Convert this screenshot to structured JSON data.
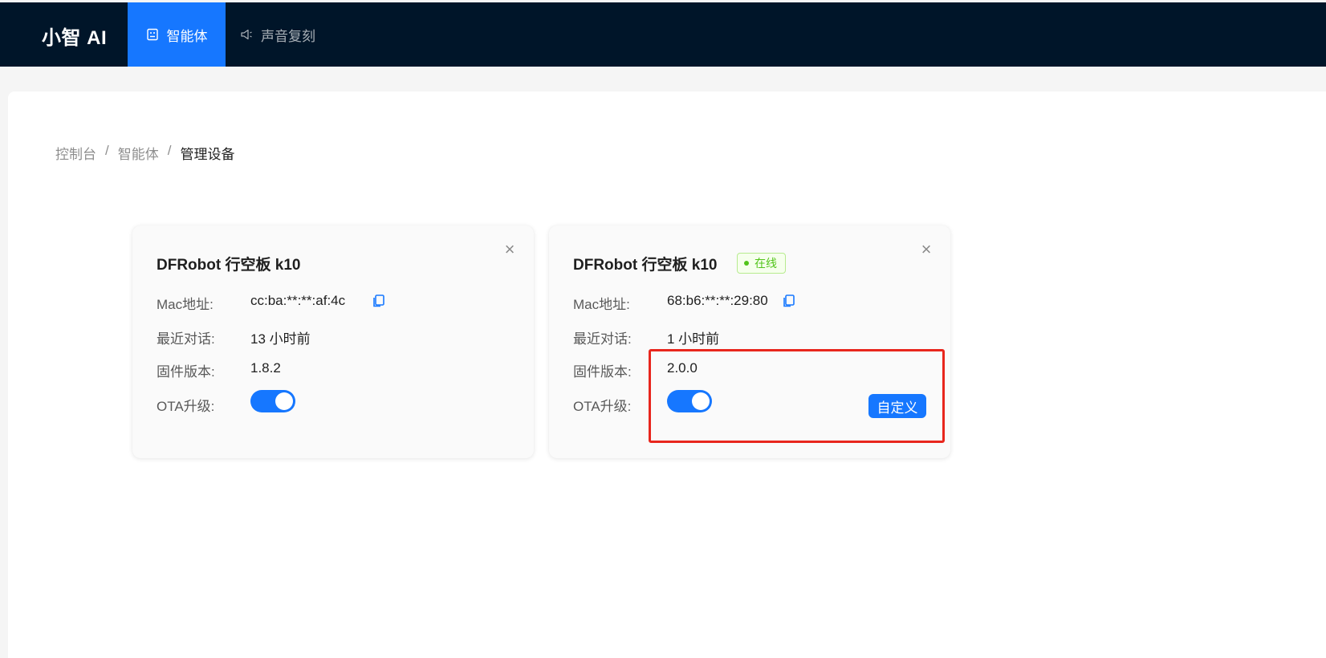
{
  "header": {
    "brand": "小智 AI",
    "nav": [
      {
        "label": "智能体",
        "icon": "robot-icon",
        "active": true
      },
      {
        "label": "声音复刻",
        "icon": "sound-icon",
        "active": false
      }
    ],
    "active_color": "#1677ff",
    "background": "#001529"
  },
  "breadcrumb": {
    "items": [
      "控制台",
      "智能体",
      "管理设备"
    ],
    "separator": "/"
  },
  "devices": [
    {
      "title": "DFRobot 行空板 k10",
      "online": false,
      "mac_label": "Mac地址:",
      "mac": "cc:ba:**:**:af:4c",
      "last_chat_label": "最近对话:",
      "last_chat": "13 小时前",
      "firmware_label": "固件版本:",
      "firmware": "1.8.2",
      "ota_label": "OTA升级:",
      "ota_enabled": true
    },
    {
      "title": "DFRobot 行空板 k10",
      "online": true,
      "status_label": "在线",
      "mac_label": "Mac地址:",
      "mac": "68:b6:**:**:29:80",
      "last_chat_label": "最近对话:",
      "last_chat": "1 小时前",
      "firmware_label": "固件版本:",
      "firmware": "2.0.0",
      "ota_label": "OTA升级:",
      "ota_enabled": true,
      "custom_button": "自定义"
    }
  ],
  "annotation": {
    "color": "#e8261d"
  }
}
